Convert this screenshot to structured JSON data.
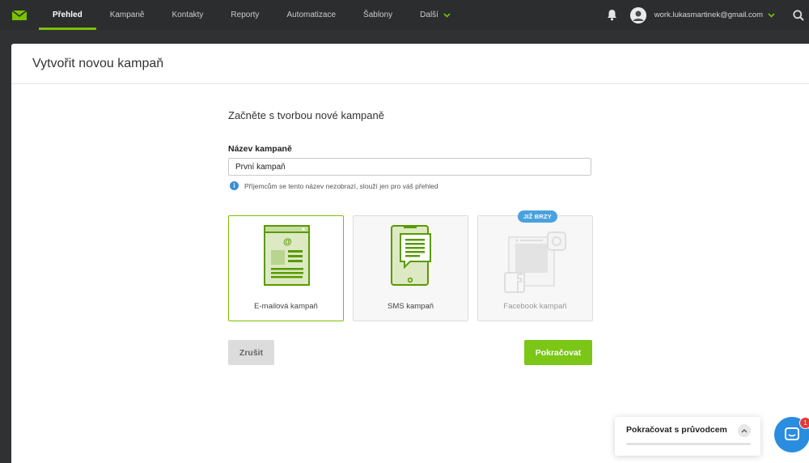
{
  "nav": {
    "items": [
      {
        "label": "Přehled",
        "active": true
      },
      {
        "label": "Kampaně"
      },
      {
        "label": "Kontakty"
      },
      {
        "label": "Reporty"
      },
      {
        "label": "Automatizace"
      },
      {
        "label": "Šablony"
      },
      {
        "label": "Další"
      }
    ],
    "email": "work.lukasmartinek@gmail.com",
    "accent": "#7bc100"
  },
  "modal": {
    "title": "Vytvořit novou kampaň",
    "subtitle": "Začněte s tvorbou nové kampaně",
    "name_label": "Název kampaně",
    "name_value": "První kampaň",
    "hint": "Příjemcům se tento název nezobrazí, slouží jen pro váš přehled",
    "cards": [
      {
        "label": "E-mailová kampaň",
        "icon": "email-campaign-icon",
        "selected": true
      },
      {
        "label": "SMS kampaň",
        "icon": "sms-campaign-icon"
      },
      {
        "label": "Facebook kampaň",
        "icon": "facebook-campaign-icon",
        "badge": "JIŽ BRZY",
        "disabled": true
      }
    ],
    "cancel_label": "Zrušit",
    "continue_label": "Pokračovat"
  },
  "guide": {
    "label": "Pokračovat s průvodcem"
  },
  "chat": {
    "badge_count": "1"
  }
}
